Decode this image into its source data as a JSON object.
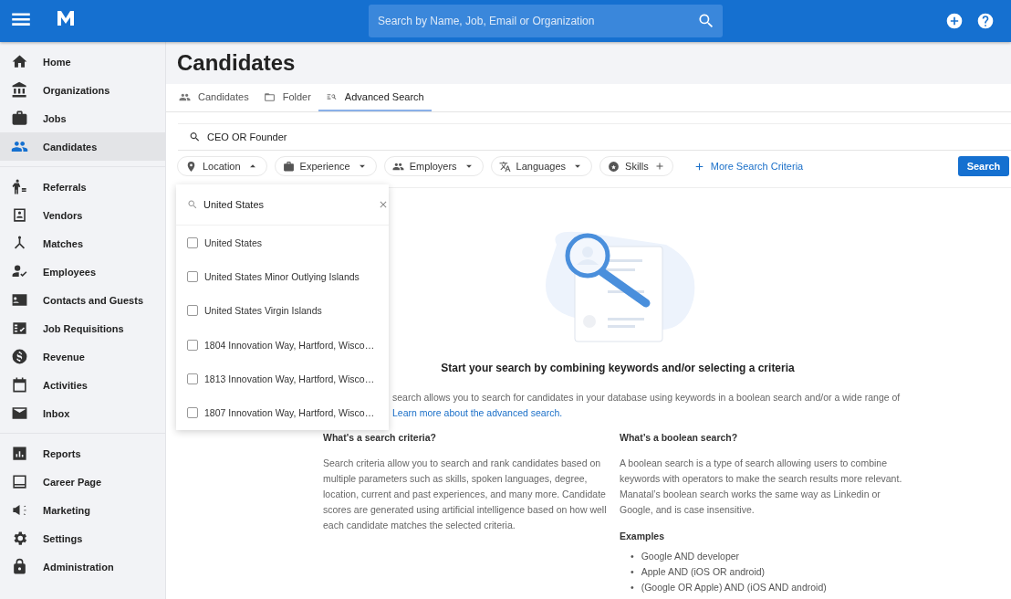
{
  "topbar": {
    "search_placeholder": "Search by Name, Job, Email or Organization"
  },
  "sidebar": {
    "sections": [
      {
        "items": [
          {
            "label": "Home",
            "selected": false
          },
          {
            "label": "Organizations",
            "selected": false
          },
          {
            "label": "Jobs",
            "selected": false
          },
          {
            "label": "Candidates",
            "selected": true
          }
        ]
      },
      {
        "items": [
          {
            "label": "Referrals",
            "selected": false
          },
          {
            "label": "Vendors",
            "selected": false
          },
          {
            "label": "Matches",
            "selected": false
          },
          {
            "label": "Employees",
            "selected": false
          },
          {
            "label": "Contacts and Guests",
            "selected": false
          },
          {
            "label": "Job Requisitions",
            "selected": false
          },
          {
            "label": "Revenue",
            "selected": false
          },
          {
            "label": "Activities",
            "selected": false
          },
          {
            "label": "Inbox",
            "selected": false
          }
        ]
      },
      {
        "items": [
          {
            "label": "Reports",
            "selected": false
          },
          {
            "label": "Career Page",
            "selected": false
          },
          {
            "label": "Marketing",
            "selected": false
          },
          {
            "label": "Settings",
            "selected": false
          },
          {
            "label": "Administration",
            "selected": false
          }
        ]
      }
    ]
  },
  "page_title": "Candidates",
  "tabs": [
    {
      "label": "Candidates",
      "selected": false
    },
    {
      "label": "Folder",
      "selected": false
    },
    {
      "label": "Advanced Search",
      "selected": true
    }
  ],
  "keyword_field": {
    "value": "CEO OR Founder"
  },
  "filters": [
    {
      "label": "Location",
      "kind": "dropdown",
      "expanded": true
    },
    {
      "label": "Experience",
      "kind": "dropdown",
      "expanded": false
    },
    {
      "label": "Employers",
      "kind": "dropdown",
      "expanded": false
    },
    {
      "label": "Languages",
      "kind": "dropdown",
      "expanded": false
    },
    {
      "label": "Skills",
      "kind": "add"
    }
  ],
  "more_criteria": "More Search Criteria",
  "search_button": "Search",
  "location_dropdown": {
    "search_value": "United States",
    "options": [
      {
        "label": "United States",
        "checked": false
      },
      {
        "label": "United States Minor Outlying Islands",
        "checked": false
      },
      {
        "label": "United States Virgin Islands",
        "checked": false
      },
      {
        "label": "1804 Innovation Way, Hartford, Wisco…",
        "checked": false
      },
      {
        "label": "1813 Innovation Way, Hartford, Wisco…",
        "checked": false
      },
      {
        "label": "1807 Innovation Way, Hartford, Wisco…",
        "checked": false
      }
    ]
  },
  "empty_state": {
    "heading": "Start your search by combining keywords and/or selecting a criteria",
    "intro": "search allows you to search for candidates in your database using keywords in a boolean search and/or a wide range of",
    "link": "Learn more about the advanced search.",
    "columns": [
      {
        "heading": "What's a search criteria?",
        "body": "Search criteria allow you to search and rank candidates based on multiple parameters such as skills, spoken languages, degree, location, current and past experiences, and many more. Candidate scores are generated using artificial intelligence based on how well each candidate matches the selected criteria."
      },
      {
        "heading": "What’s a boolean search?",
        "body": "A boolean search is a type of search allowing users to combine keywords with operators to make the search results more relevant. Manatal’s boolean search works the same way as Linkedin or Google, and is case insensitive.",
        "examples_heading": "Examples",
        "examples": [
          {
            "marker": "•",
            "text": "Google AND developer"
          },
          {
            "marker": "•",
            "text": "Apple AND (iOS OR android)"
          },
          {
            "marker": "•",
            "text": "(Google OR Apple) AND (iOS AND android)"
          }
        ]
      }
    ]
  }
}
